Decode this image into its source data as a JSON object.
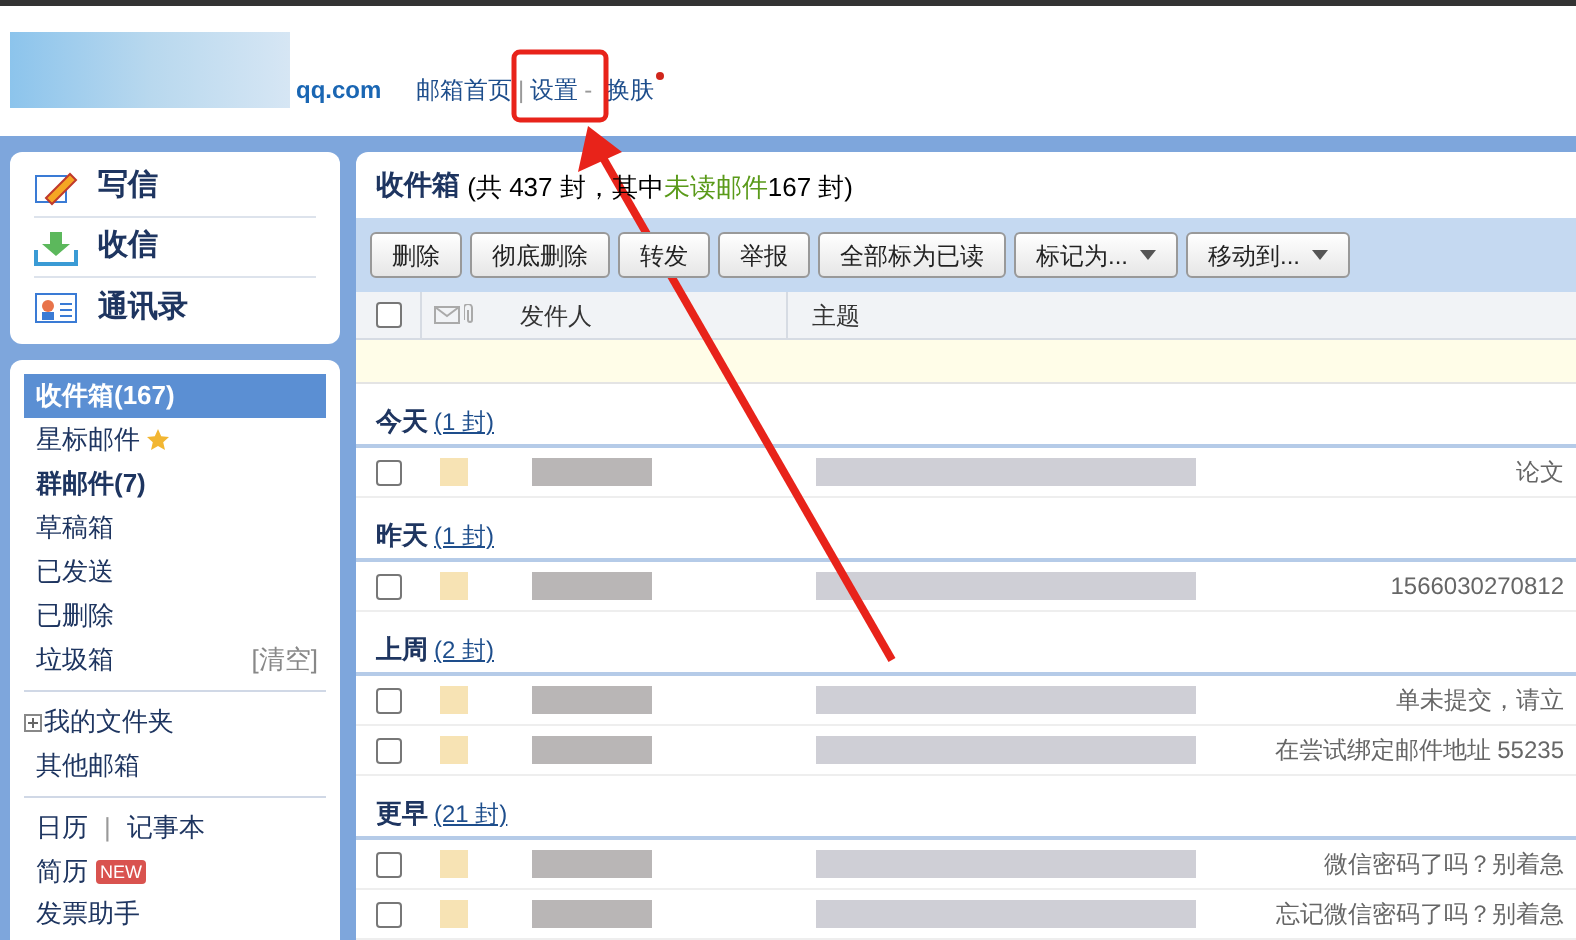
{
  "header": {
    "logo_text": "qq.com",
    "links": [
      {
        "label": "邮箱首页"
      },
      {
        "separator": "|",
        "label": "设置"
      },
      {
        "separator": "-",
        "label": "换肤",
        "badge": true
      }
    ]
  },
  "actions": [
    {
      "kind": "compose",
      "label": "写信"
    },
    {
      "kind": "receive",
      "label": "收信"
    },
    {
      "kind": "contacts",
      "label": "通讯录"
    }
  ],
  "folders": [
    {
      "label": "收件箱(167)",
      "selected": true,
      "bold": true
    },
    {
      "label": "星标邮件",
      "selected": false,
      "bold": false,
      "star": true
    },
    {
      "label": "群邮件(7)",
      "selected": false,
      "bold": true
    },
    {
      "label": "草稿箱",
      "selected": false,
      "bold": false
    },
    {
      "label": "已发送",
      "selected": false,
      "bold": false
    },
    {
      "label": "已删除",
      "selected": false,
      "bold": false
    },
    {
      "label": "垃圾箱",
      "selected": false,
      "bold": false,
      "action": "[清空]"
    }
  ],
  "my_folders": {
    "label": "我的文件夹",
    "expanded": false
  },
  "other_mail": "其他邮箱",
  "tools": {
    "calendar": "日历",
    "separator": "|",
    "notes": "记事本",
    "resume": "简历",
    "resume_badge": "NEW",
    "invoice": "发票助手"
  },
  "inbox": {
    "title": "收件箱",
    "summary_start": "(共 437 封，其中 ",
    "unread_label": "未读邮件",
    "summary_end": " 167 封)"
  },
  "toolbar": [
    {
      "label": "删除",
      "dropdown": false
    },
    {
      "label": "彻底删除",
      "dropdown": false
    },
    {
      "label": "转发",
      "dropdown": false
    },
    {
      "label": "举报",
      "dropdown": false
    },
    {
      "label": "全部标为已读",
      "dropdown": false
    },
    {
      "label": "标记为...",
      "dropdown": true
    },
    {
      "label": "移动到...",
      "dropdown": true
    }
  ],
  "columns": {
    "select_all": false,
    "sender": "发件人",
    "subject": "主题"
  },
  "groups": [
    {
      "label": "今天",
      "count": "(1 封)",
      "rows": [
        {
          "checked": false,
          "text": "论文"
        }
      ]
    },
    {
      "label": "昨天",
      "count": "(1 封)",
      "rows": [
        {
          "checked": false,
          "text": "1566030270812"
        }
      ]
    },
    {
      "label": "上周",
      "count": "(2 封)",
      "rows": [
        {
          "checked": false,
          "text": "单未提交，请立"
        },
        {
          "checked": false,
          "text": "在尝试绑定邮件地址 55235"
        }
      ]
    },
    {
      "label": "更早",
      "count": "(21 封)",
      "rows": [
        {
          "checked": false,
          "text": "微信密码了吗？别着急"
        },
        {
          "checked": false,
          "text": "忘记微信密码了吗？别着急"
        }
      ]
    }
  ]
}
